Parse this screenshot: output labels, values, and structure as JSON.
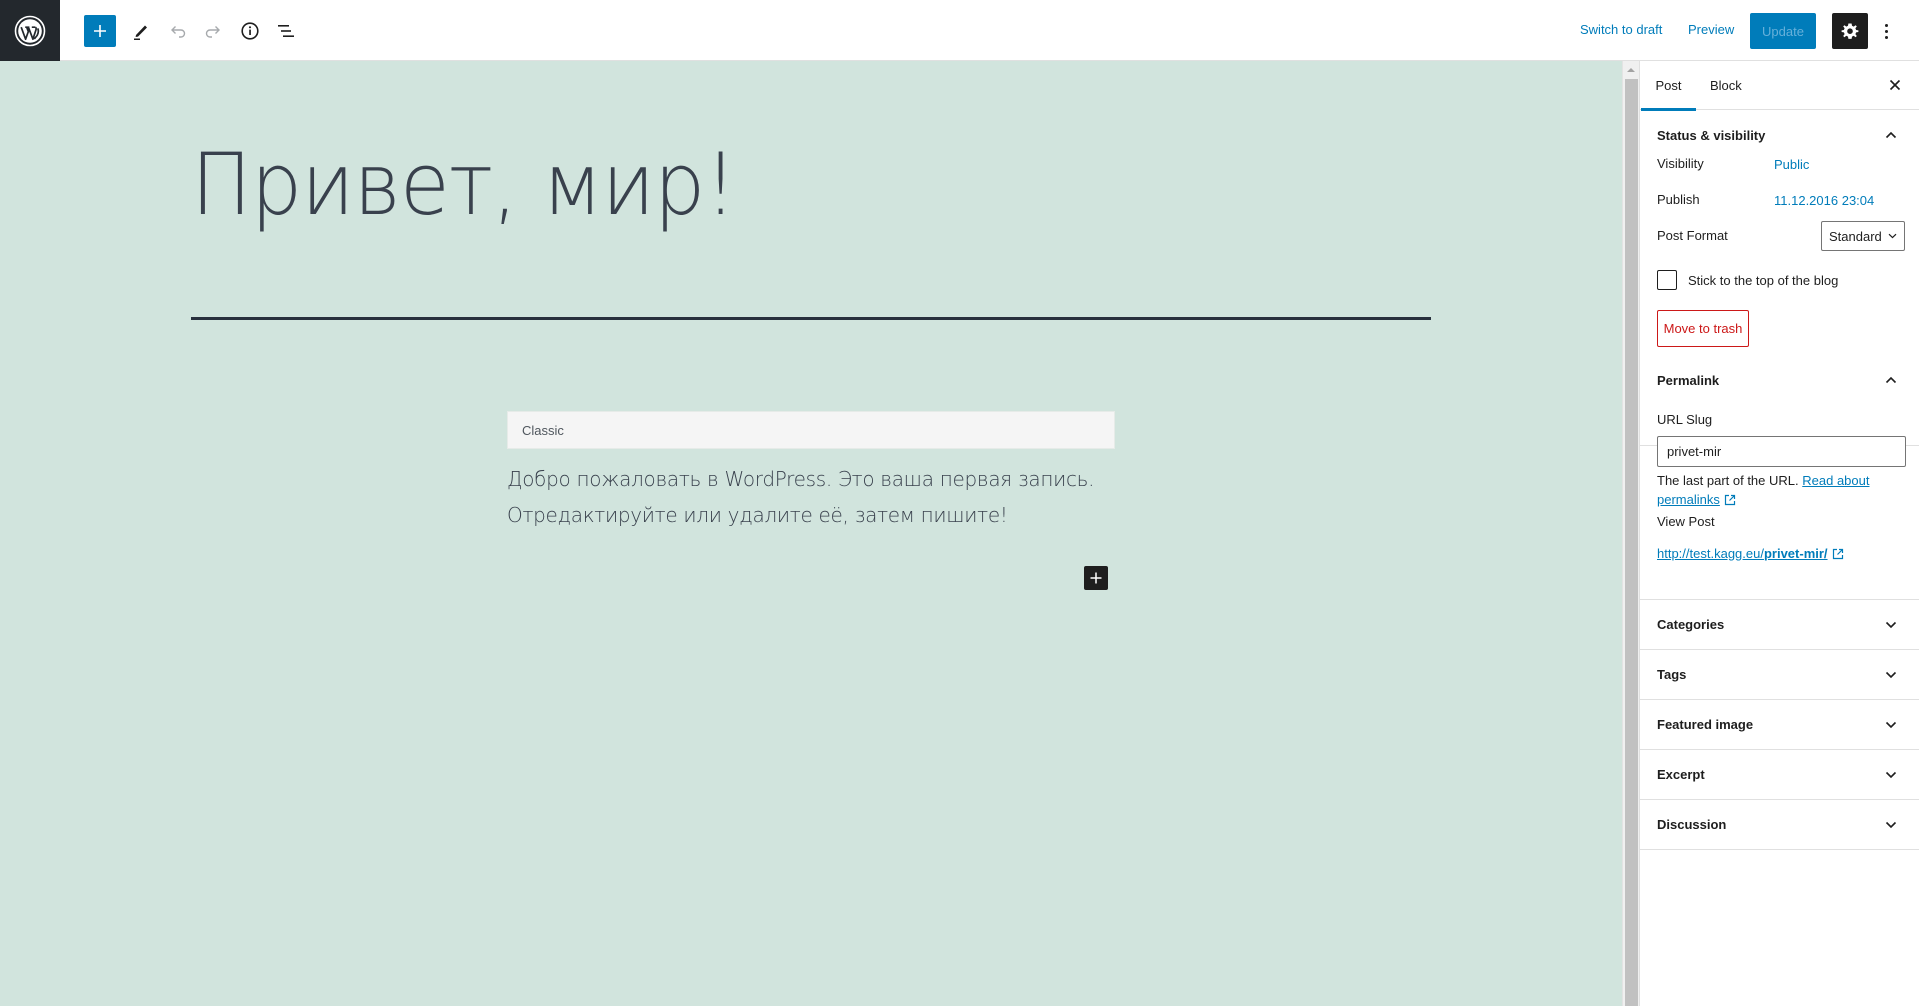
{
  "toolbar": {
    "logo": "wordpress-logo",
    "inserter_icon": "plus-icon",
    "tools_icon": "pencil-icon",
    "undo_icon": "undo-icon",
    "redo_icon": "redo-icon",
    "details_icon": "info-icon",
    "list_view_icon": "list-view-icon",
    "switch_to_draft": "Switch to draft",
    "preview": "Preview",
    "update": "Update",
    "settings_icon": "gear-icon",
    "more_icon": "more-vertical-icon"
  },
  "editor": {
    "post_title": "Привет, мир!",
    "classic_block_label": "Classic",
    "classic_paragraphs": [
      "Добро пожаловать в WordPress. Это ваша первая запись.",
      "Отредактируйте или удалите её, затем пишите!"
    ],
    "append_block_icon": "plus-icon",
    "background_color": "#d1e4dd"
  },
  "sidebar": {
    "tabs": [
      {
        "label": "Post",
        "active": true
      },
      {
        "label": "Block",
        "active": false
      }
    ],
    "close_icon": "close-icon",
    "status_visibility": {
      "title": "Status & visibility",
      "expanded": true,
      "visibility_label": "Visibility",
      "visibility_value": "Public",
      "publish_label": "Publish",
      "publish_value": "11.12.2016 23:04",
      "post_format_label": "Post Format",
      "post_format_value": "Standard",
      "sticky_label": "Stick to the top of the blog",
      "sticky_checked": false,
      "trash_label": "Move to trash"
    },
    "permalink": {
      "title": "Permalink",
      "expanded": true,
      "slug_label": "URL Slug",
      "slug_value": "privet-mir",
      "help_text": "The last part of the URL.",
      "help_link_line1": "Read about",
      "help_link_line2": "permalinks",
      "view_post_label": "View Post",
      "view_post_url_prefix": "http://test.kagg.eu/",
      "view_post_url_slug": "privet-mir/"
    },
    "panels": [
      {
        "title": "Categories",
        "expanded": false
      },
      {
        "title": "Tags",
        "expanded": false
      },
      {
        "title": "Featured image",
        "expanded": false
      },
      {
        "title": "Excerpt",
        "expanded": false
      },
      {
        "title": "Discussion",
        "expanded": false
      }
    ]
  },
  "colors": {
    "accent": "#007cba",
    "danger": "#cc1818",
    "dark": "#1e1e1e",
    "logo_bg": "#23282d"
  }
}
